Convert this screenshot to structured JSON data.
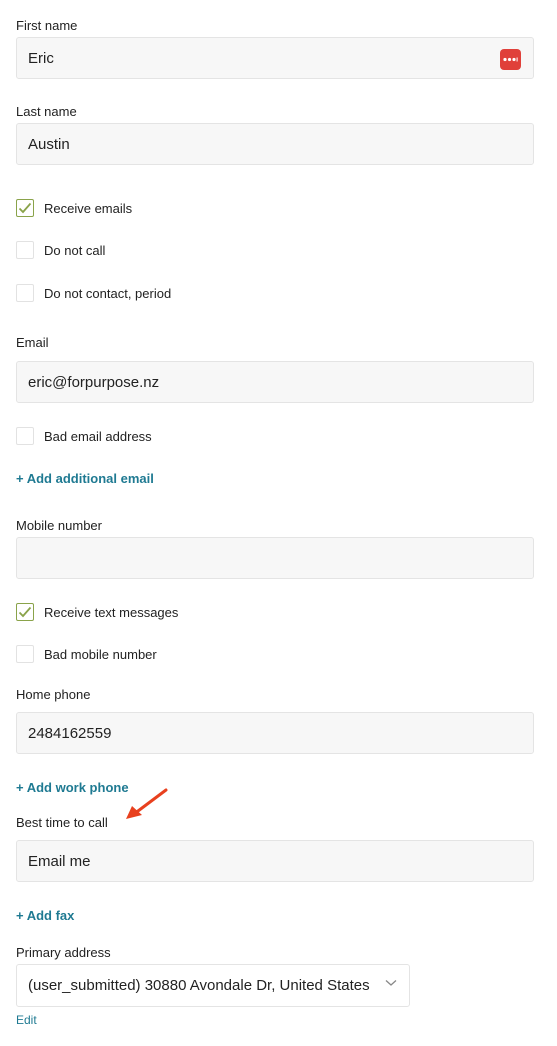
{
  "first_name": {
    "label": "First name",
    "value": "Eric"
  },
  "last_name": {
    "label": "Last name",
    "value": "Austin"
  },
  "receive_emails": {
    "label": "Receive emails",
    "checked": true
  },
  "do_not_call": {
    "label": "Do not call",
    "checked": false
  },
  "do_not_contact": {
    "label": "Do not contact, period",
    "checked": false
  },
  "email": {
    "label": "Email",
    "value": "eric@forpurpose.nz"
  },
  "bad_email": {
    "label": "Bad email address",
    "checked": false
  },
  "add_additional_email": "+ Add additional email",
  "mobile": {
    "label": "Mobile number",
    "value": ""
  },
  "receive_texts": {
    "label": "Receive text messages",
    "checked": true
  },
  "bad_mobile": {
    "label": "Bad mobile number",
    "checked": false
  },
  "home_phone": {
    "label": "Home phone",
    "value": "2484162559"
  },
  "add_work_phone": "+ Add work phone",
  "best_time": {
    "label": "Best time to call",
    "value": "Email me"
  },
  "add_fax": "+ Add fax",
  "primary_address": {
    "label": "Primary address",
    "selected": "(user_submitted) 30880 Avondale Dr, United States",
    "edit_label": "Edit"
  },
  "colors": {
    "accent_link": "#1f7a92",
    "check_green": "#8aa34a",
    "arrow_red": "#e8401e",
    "password_icon": "#e0403a"
  }
}
